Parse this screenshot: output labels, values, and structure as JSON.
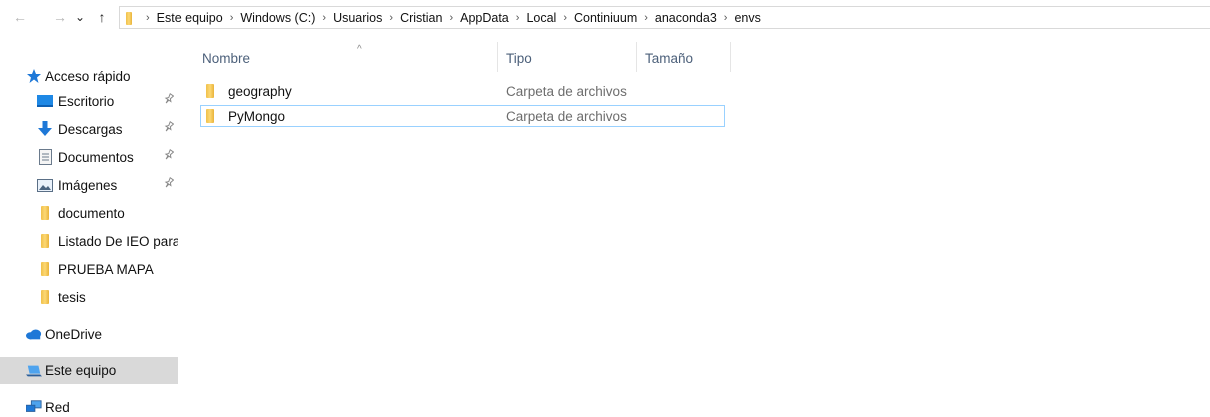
{
  "nav_buttons": {
    "back": "←",
    "forward": "→",
    "recent": "⌄",
    "up": "↑"
  },
  "breadcrumb": [
    "Este equipo",
    "Windows (C:)",
    "Usuarios",
    "Cristian",
    "AppData",
    "Local",
    "Continiuum",
    "anaconda3",
    "envs"
  ],
  "breadcrumb_separator": "›",
  "sidebar": {
    "quick_access": "Acceso rápido",
    "items": [
      {
        "label": "Escritorio",
        "icon": "desktop-icon",
        "pinned": true
      },
      {
        "label": "Descargas",
        "icon": "download-icon",
        "pinned": true
      },
      {
        "label": "Documentos",
        "icon": "documents-icon",
        "pinned": true
      },
      {
        "label": "Imágenes",
        "icon": "pictures-icon",
        "pinned": true
      },
      {
        "label": "documento",
        "icon": "folder-icon",
        "pinned": false
      },
      {
        "label": "Listado De IEO para",
        "icon": "folder-icon",
        "pinned": false
      },
      {
        "label": "PRUEBA MAPA",
        "icon": "folder-icon",
        "pinned": false
      },
      {
        "label": "tesis",
        "icon": "folder-icon",
        "pinned": false
      }
    ],
    "onedrive": "OneDrive",
    "this_pc": "Este equipo",
    "network": "Red",
    "pin_glyph": "✈"
  },
  "columns": {
    "name": "Nombre",
    "type": "Tipo",
    "size": "Tamaño",
    "sort_glyph": "^"
  },
  "files": [
    {
      "name": "geography",
      "type": "Carpeta de archivos",
      "size": ""
    },
    {
      "name": "PyMongo",
      "type": "Carpeta de archivos",
      "size": ""
    }
  ],
  "colors": {
    "accent_blue": "#1e78d7",
    "selection_gray": "#d9d9d9",
    "focus_border": "#99d1ff",
    "folder_yellow": "#f8cd5e"
  }
}
